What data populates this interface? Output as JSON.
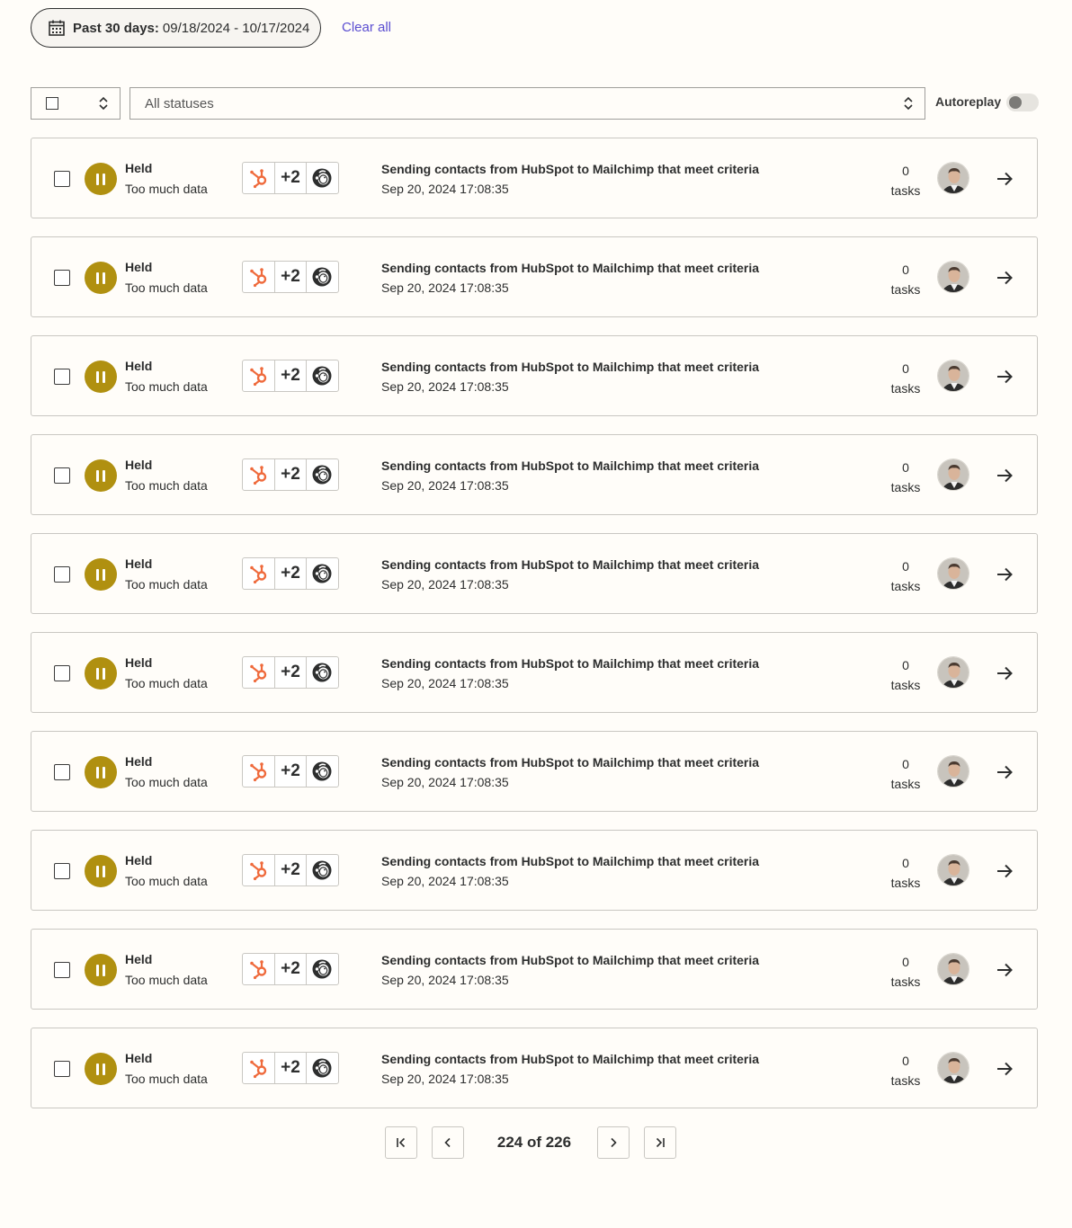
{
  "date_filter": {
    "label": "Past 30 days:",
    "range": "09/18/2024 - 10/17/2024",
    "icon": "calendar-icon"
  },
  "clear_all": "Clear all",
  "status_select": {
    "value": "All statuses"
  },
  "autoreplay": {
    "label": "Autoreplay",
    "enabled": false
  },
  "colors": {
    "held": "#b09010",
    "link": "#5b4ed1",
    "hubspot": "#ef6a3c"
  },
  "runs": [
    {
      "status": "Held",
      "reason": "Too much data",
      "apps_more": "+2",
      "title": "Sending contacts from HubSpot to Mailchimp that meet criteria",
      "date": "Sep 20, 2024 17:08:35",
      "task_count": "0",
      "task_label": "tasks"
    },
    {
      "status": "Held",
      "reason": "Too much data",
      "apps_more": "+2",
      "title": "Sending contacts from HubSpot to Mailchimp that meet criteria",
      "date": "Sep 20, 2024 17:08:35",
      "task_count": "0",
      "task_label": "tasks"
    },
    {
      "status": "Held",
      "reason": "Too much data",
      "apps_more": "+2",
      "title": "Sending contacts from HubSpot to Mailchimp that meet criteria",
      "date": "Sep 20, 2024 17:08:35",
      "task_count": "0",
      "task_label": "tasks"
    },
    {
      "status": "Held",
      "reason": "Too much data",
      "apps_more": "+2",
      "title": "Sending contacts from HubSpot to Mailchimp that meet criteria",
      "date": "Sep 20, 2024 17:08:35",
      "task_count": "0",
      "task_label": "tasks"
    },
    {
      "status": "Held",
      "reason": "Too much data",
      "apps_more": "+2",
      "title": "Sending contacts from HubSpot to Mailchimp that meet criteria",
      "date": "Sep 20, 2024 17:08:35",
      "task_count": "0",
      "task_label": "tasks"
    },
    {
      "status": "Held",
      "reason": "Too much data",
      "apps_more": "+2",
      "title": "Sending contacts from HubSpot to Mailchimp that meet criteria",
      "date": "Sep 20, 2024 17:08:35",
      "task_count": "0",
      "task_label": "tasks"
    },
    {
      "status": "Held",
      "reason": "Too much data",
      "apps_more": "+2",
      "title": "Sending contacts from HubSpot to Mailchimp that meet criteria",
      "date": "Sep 20, 2024 17:08:35",
      "task_count": "0",
      "task_label": "tasks"
    },
    {
      "status": "Held",
      "reason": "Too much data",
      "apps_more": "+2",
      "title": "Sending contacts from HubSpot to Mailchimp that meet criteria",
      "date": "Sep 20, 2024 17:08:35",
      "task_count": "0",
      "task_label": "tasks"
    },
    {
      "status": "Held",
      "reason": "Too much data",
      "apps_more": "+2",
      "title": "Sending contacts from HubSpot to Mailchimp that meet criteria",
      "date": "Sep 20, 2024 17:08:35",
      "task_count": "0",
      "task_label": "tasks"
    },
    {
      "status": "Held",
      "reason": "Too much data",
      "apps_more": "+2",
      "title": "Sending contacts from HubSpot to Mailchimp that meet criteria",
      "date": "Sep 20, 2024 17:08:35",
      "task_count": "0",
      "task_label": "tasks"
    }
  ],
  "pagination": {
    "label": "224 of 226"
  }
}
